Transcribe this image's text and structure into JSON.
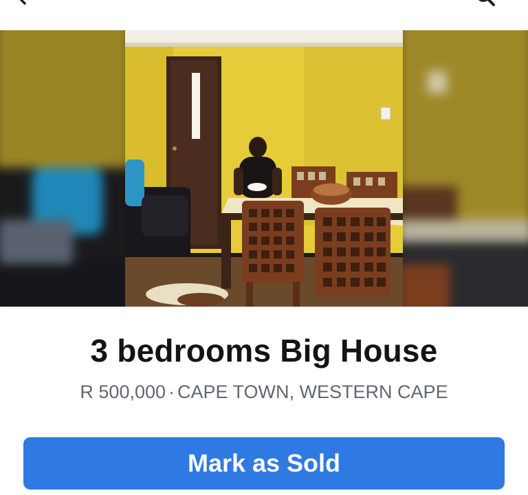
{
  "header": {
    "back_icon": "arrow-back-icon",
    "search_icon": "search-icon"
  },
  "listing": {
    "photo_description_icon": "listing-photo",
    "title": "3 bedrooms Big House",
    "price": "R 500,000",
    "separator": "·",
    "location": "CAPE TOWN, WESTERN CAPE"
  },
  "actions": {
    "mark_sold_label": "Mark as Sold"
  },
  "colors": {
    "accent": "#2f79e3",
    "title_text": "#141414",
    "subtitle_text": "#606770",
    "wall_yellow": "#e8cf3a"
  }
}
